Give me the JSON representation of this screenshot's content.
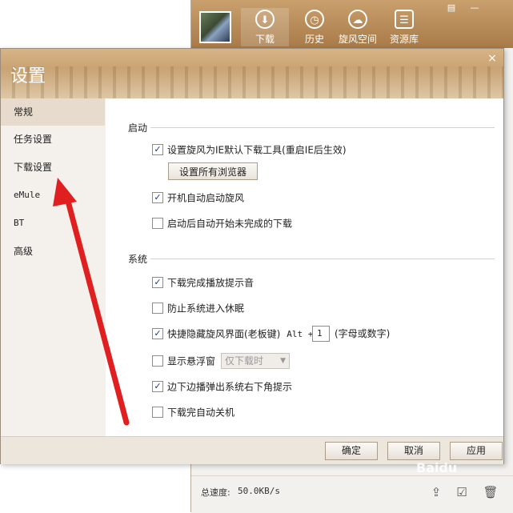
{
  "main_window": {
    "nav": [
      {
        "label": "下载",
        "icon": "download-icon",
        "active": true
      },
      {
        "label": "历史",
        "icon": "history-clock-icon",
        "active": false
      },
      {
        "label": "旋风空间",
        "icon": "cloud-space-icon",
        "active": false
      },
      {
        "label": "资源库",
        "icon": "resource-library-icon",
        "active": false
      }
    ],
    "footer": {
      "speed_label": "总速度:",
      "speed_value": "50.0KB/s"
    }
  },
  "dialog": {
    "title": "设置",
    "close_glyph": "×",
    "sidebar": [
      {
        "label": "常规",
        "active": true
      },
      {
        "label": "任务设置",
        "active": false
      },
      {
        "label": "下载设置",
        "active": false
      },
      {
        "label": "eMule",
        "active": false
      },
      {
        "label": "BT",
        "active": false
      },
      {
        "label": "高级",
        "active": false
      }
    ],
    "sections": {
      "startup": {
        "title": "启动",
        "options": [
          {
            "label": "设置旋风为IE默认下载工具(重启IE后生效)",
            "checked": true
          },
          {
            "label": "开机自动启动旋风",
            "checked": true
          },
          {
            "label": "启动后自动开始未完成的下载",
            "checked": false
          }
        ],
        "set_browsers_button": "设置所有浏览器"
      },
      "system": {
        "title": "系统",
        "opt_sound": {
          "label": "下载完成播放提示音",
          "checked": true
        },
        "opt_sleep": {
          "label": "防止系统进入休眠",
          "checked": false
        },
        "opt_hotkey": {
          "label": "快捷隐藏旋风界面(老板键)",
          "checked": true,
          "alt": "Alt +",
          "key_value": "1",
          "hint": "(字母或数字)"
        },
        "opt_float": {
          "label": "显示悬浮窗",
          "checked": false,
          "select_value": "仅下载时"
        },
        "opt_popup": {
          "label": "边下边播弹出系统右下角提示",
          "checked": true
        },
        "opt_shutdown": {
          "label": "下载完自动关机",
          "checked": false
        }
      }
    },
    "buttons": {
      "ok": "确定",
      "cancel": "取消",
      "apply": "应用"
    }
  },
  "watermark": "Baidu",
  "colors": {
    "annotation_arrow": "#e02020",
    "header_tan": "#c9a373",
    "check_mark": "#1a3a8a"
  }
}
